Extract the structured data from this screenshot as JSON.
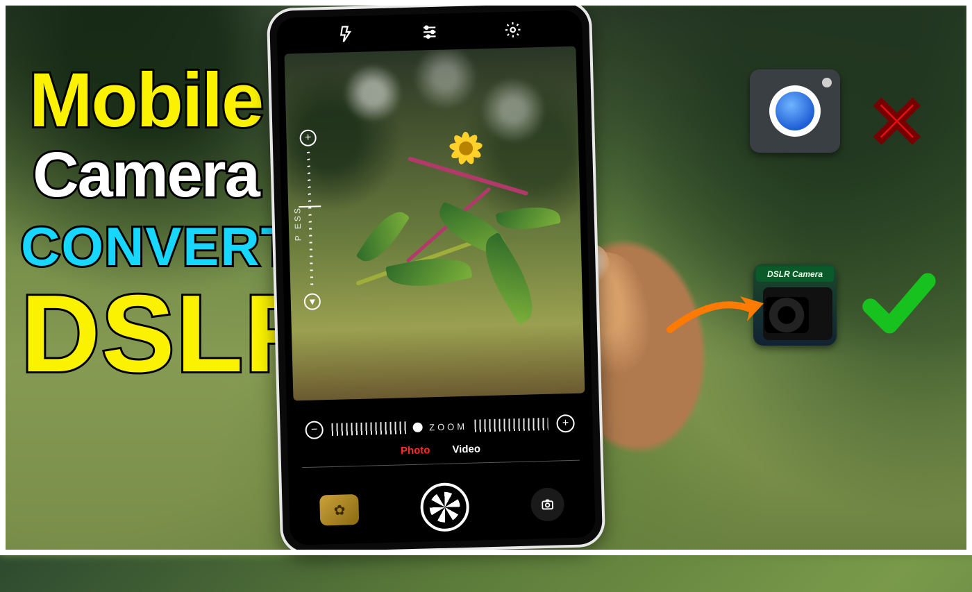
{
  "headline": {
    "mobile": "Mobile",
    "camera": "Camera",
    "convert": "CONVERT",
    "dslr": "DSLR"
  },
  "phone": {
    "slider_label": "P        ESS",
    "zoom_label": "ZOOM",
    "modes": {
      "photo": "Photo",
      "video": "Video"
    }
  },
  "apps": {
    "dslr_title": "DSLR Camera"
  },
  "marks": {
    "cross": "✕"
  },
  "colors": {
    "yellow": "#faf200",
    "cyan": "#17d7ff",
    "red": "#d11",
    "green": "#17c21e"
  }
}
